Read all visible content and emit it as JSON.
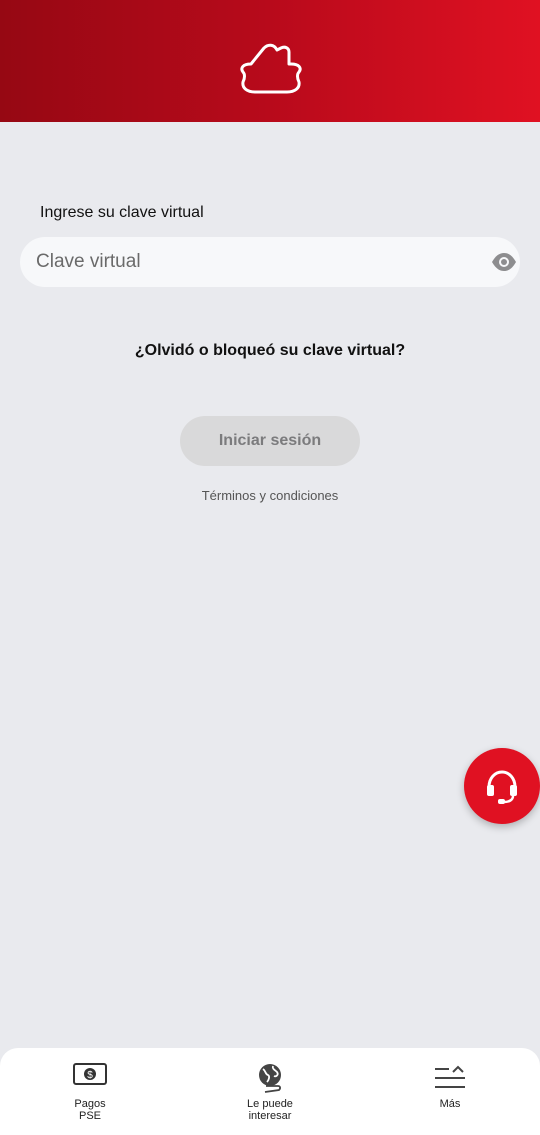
{
  "colors": {
    "brand_red": "#e01122",
    "brand_dark_red": "#960813",
    "background": "#e9eaee"
  },
  "header": {
    "logo_icon": "house-outline-icon"
  },
  "login": {
    "field_label": "Ingrese su clave virtual",
    "password_placeholder": "Clave virtual",
    "password_value": "",
    "toggle_icon": "eye-icon",
    "forgot_link": "¿Olvidó o bloqueó su clave virtual?",
    "submit_label": "Iniciar sesión",
    "terms_link": "Términos y condiciones"
  },
  "support_fab": {
    "icon": "headset-icon"
  },
  "bottom_nav": {
    "items": [
      {
        "label": "Pagos\nPSE",
        "icon": "banknote-icon"
      },
      {
        "label": "Le puede\ninteresar",
        "icon": "globe-icon"
      },
      {
        "label": "Más",
        "icon": "menu-icon"
      }
    ]
  }
}
